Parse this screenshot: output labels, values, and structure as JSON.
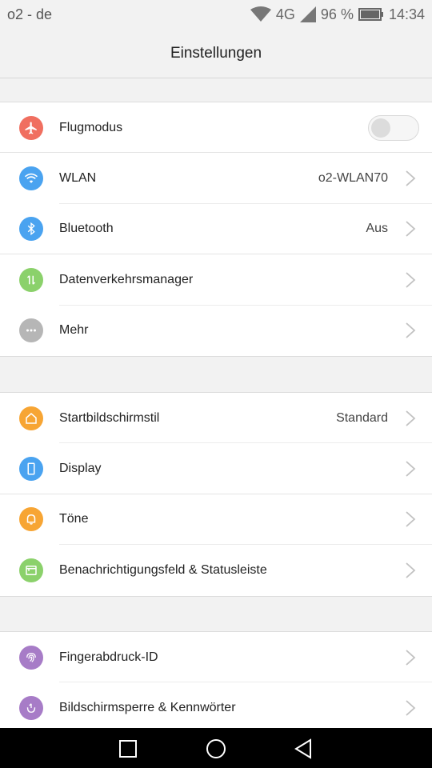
{
  "status": {
    "carrier": "o2 - de",
    "network": "4G",
    "battery": "96 %",
    "time": "14:34"
  },
  "header": {
    "title": "Einstellungen"
  },
  "colors": {
    "red": "#f06f60",
    "blue": "#4aa3f0",
    "green": "#8bd16b",
    "gray": "#b6b6b6",
    "orange": "#f7a534",
    "purple": "#a77cc7"
  },
  "items": [
    {
      "label": "Flugmodus",
      "value": "",
      "icon": "airplane-icon",
      "toggle": false
    },
    {
      "label": "WLAN",
      "value": "o2-WLAN70",
      "icon": "wifi-icon"
    },
    {
      "label": "Bluetooth",
      "value": "Aus",
      "icon": "bluetooth-icon"
    },
    {
      "label": "Datenverkehrsmanager",
      "value": "",
      "icon": "data-traffic-icon"
    },
    {
      "label": "Mehr",
      "value": "",
      "icon": "more-icon"
    },
    {
      "label": "Startbildschirmstil",
      "value": "Standard",
      "icon": "home-icon"
    },
    {
      "label": "Display",
      "value": "",
      "icon": "display-icon"
    },
    {
      "label": "Töne",
      "value": "",
      "icon": "bell-icon"
    },
    {
      "label": "Benachrichtigungsfeld & Statusleiste",
      "value": "",
      "icon": "notification-panel-icon"
    },
    {
      "label": "Fingerabdruck-ID",
      "value": "",
      "icon": "fingerprint-icon"
    },
    {
      "label": "Bildschirmsperre & Kennwörter",
      "value": "",
      "icon": "lock-screen-icon"
    }
  ]
}
